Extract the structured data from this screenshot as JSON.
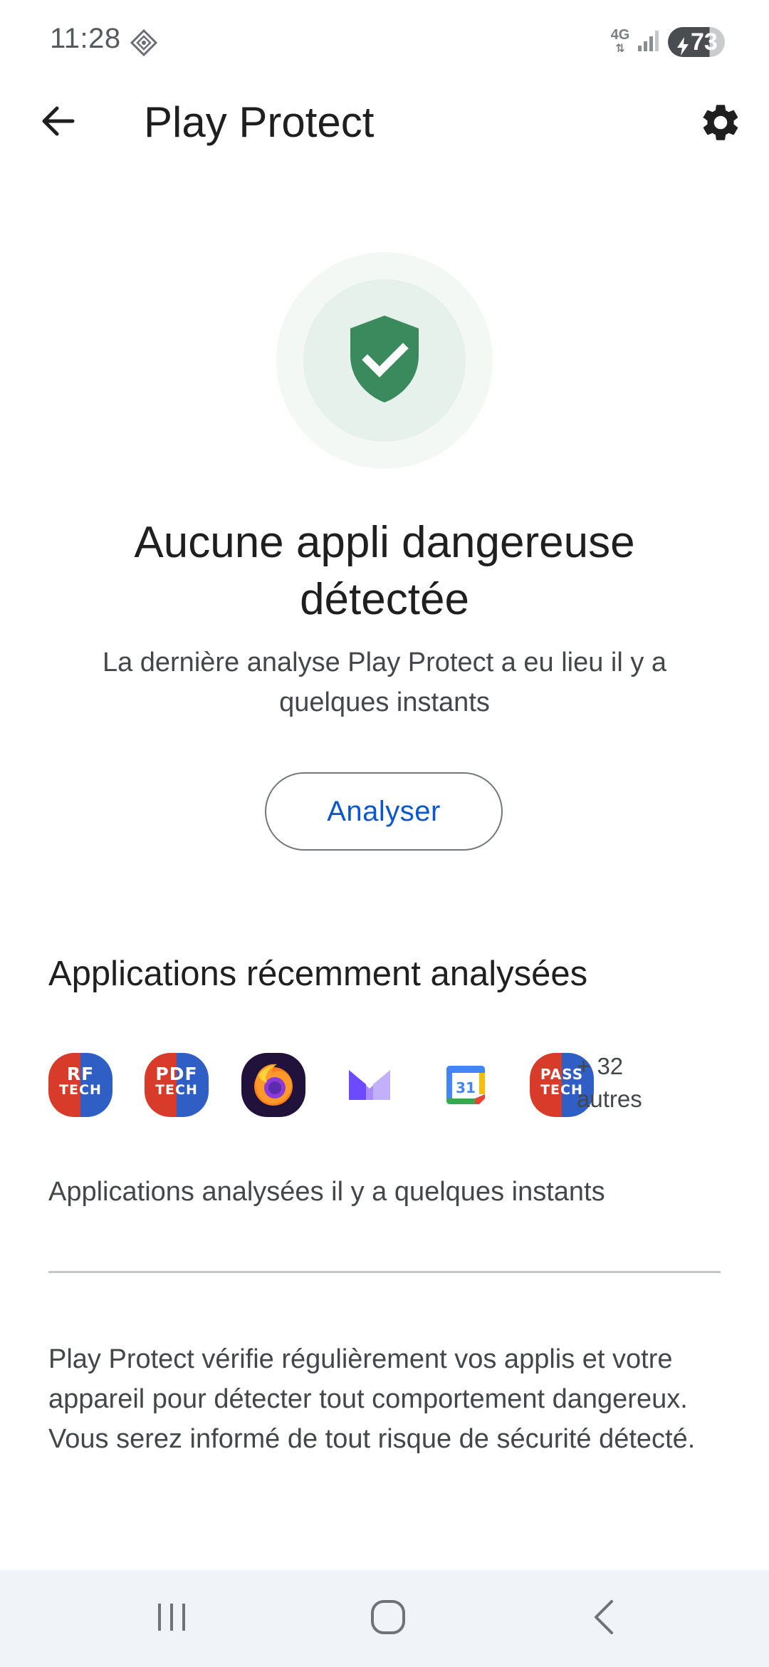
{
  "status_bar": {
    "time": "11:28",
    "network_type": "4G",
    "battery_level": "73",
    "battery_fraction": 0.73,
    "location_icon": "location-diamond-icon",
    "signal_icon": "signal-bars-icon"
  },
  "app_bar": {
    "title": "Play Protect",
    "back_icon": "arrow-back-icon",
    "settings_icon": "gear-icon"
  },
  "status_card": {
    "icon": "shield-check-icon",
    "headline": "Aucune appli dangereuse détectée",
    "subtext": "La dernière analyse Play Protect a eu lieu il y a quelques instants",
    "scan_button_label": "Analyser"
  },
  "recent": {
    "title": "Applications récemment analysées",
    "apps": [
      {
        "icon": "rf-tech-app-icon",
        "line1": "RF",
        "line2": "TECH"
      },
      {
        "icon": "pdf-tech-app-icon",
        "line1": "PDF",
        "line2": "TECH"
      },
      {
        "icon": "firefox-app-icon"
      },
      {
        "icon": "proton-mail-app-icon"
      },
      {
        "icon": "google-calendar-app-icon",
        "label": "31"
      },
      {
        "icon": "pass-tech-app-icon",
        "line1": "PASS",
        "line2": "TECH"
      }
    ],
    "more_count": "+ 32",
    "more_label": "autres",
    "scanned_time": "Applications analysées il y a quelques instants"
  },
  "info": {
    "text": "Play Protect vérifie régulièrement vos applis et votre appareil pour détecter tout comportement dangereux. Vous serez informé de tout risque de sécurité détecté."
  },
  "nav_bar": {
    "recents_icon": "recents-icon",
    "home_icon": "home-icon",
    "back_icon": "nav-back-icon"
  },
  "colors": {
    "accent_blue": "#0b57d0",
    "shield_green": "#3a8a5e",
    "shield_ring_outer": "#f3f8f5",
    "shield_ring_inner": "#e6f1eb",
    "nav_bar_bg": "#f0f3f8"
  }
}
